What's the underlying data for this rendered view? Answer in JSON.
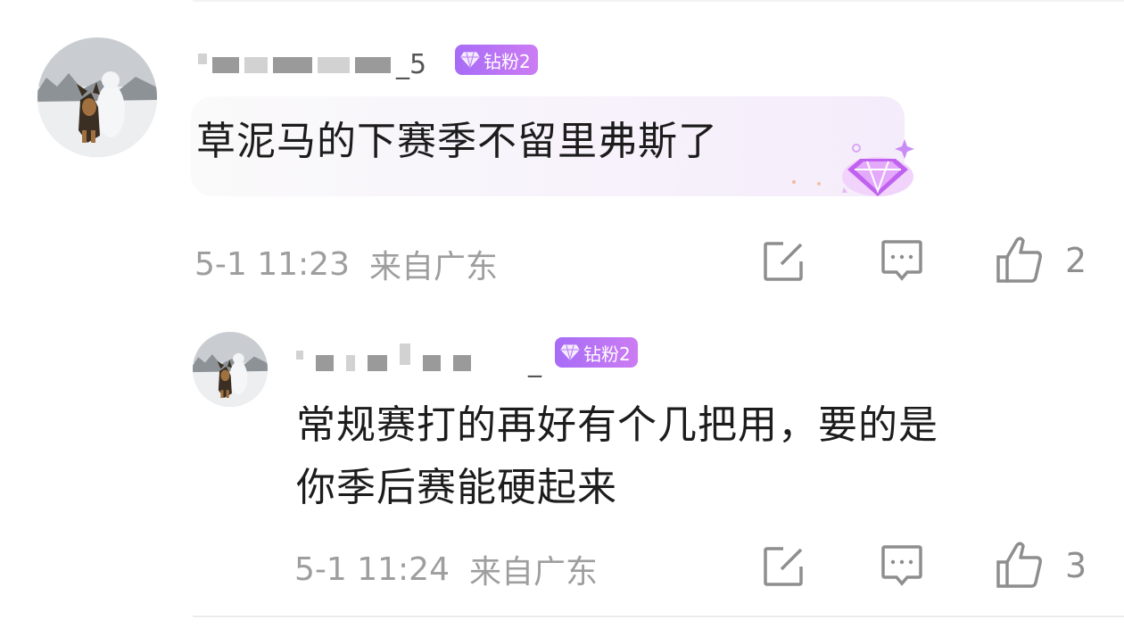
{
  "comments": [
    {
      "username_suffix": "_5",
      "badge": "钻粉2",
      "text": "草泥马的下赛季不留里弗斯了",
      "time": "5-1 11:23",
      "location": "来自广东",
      "likes": "2"
    },
    {
      "username_suffix": "_",
      "badge": "钻粉2",
      "text_line1": "常规赛打的再好有个几把用，要的是",
      "text_line2": "你季后赛能硬起来",
      "time": "5-1 11:24",
      "location": "来自广东",
      "likes": "3"
    }
  ],
  "colors": {
    "badge": "#b56ff5",
    "text": "#1c1c1c",
    "meta": "#9e9e9e"
  },
  "icons": [
    "edit-icon",
    "reply-icon",
    "thumbs-up-icon",
    "diamond-decoration-icon",
    "gem-icon"
  ]
}
